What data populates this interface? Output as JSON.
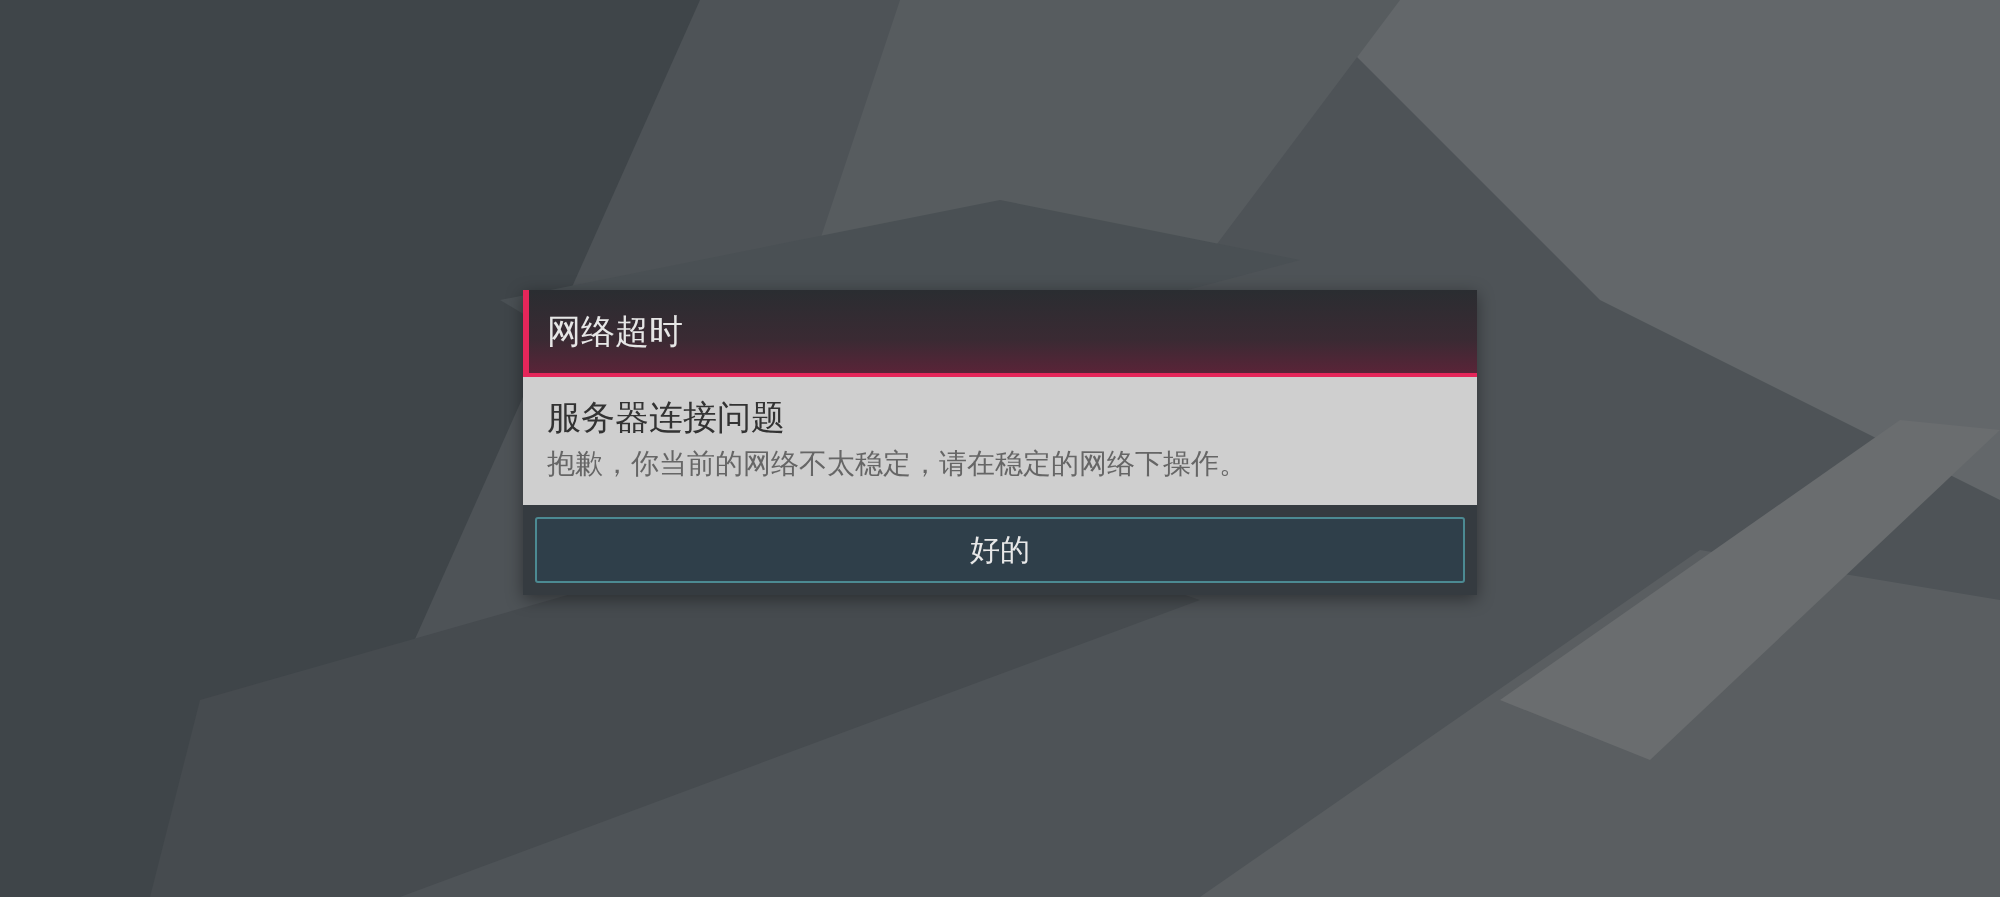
{
  "dialog": {
    "title": "网络超时",
    "heading": "服务器连接问题",
    "message": "抱歉，你当前的网络不太稳定，请在稳定的网络下操作。",
    "buttons": [
      "好的"
    ]
  }
}
